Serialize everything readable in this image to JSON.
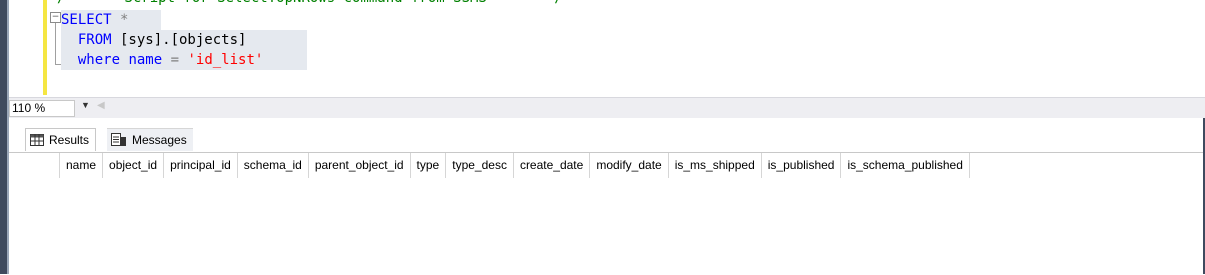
{
  "editor": {
    "comment_line": "/****** Script for SelectTopNRows command from SSMS  ******/",
    "line1_keyword": "SELECT",
    "line1_rest": " *",
    "line2_keyword": "FROM",
    "line2_rest": " [sys].[objects]",
    "line3_keyword": "where",
    "line3_ident": " name ",
    "line3_op": "=",
    "line3_string": " 'id_list'"
  },
  "zoom": {
    "value": "110 %"
  },
  "tabs": {
    "results": "Results",
    "messages": "Messages"
  },
  "grid": {
    "columns": [
      "name",
      "object_id",
      "principal_id",
      "schema_id",
      "parent_object_id",
      "type",
      "type_desc",
      "create_date",
      "modify_date",
      "is_ms_shipped",
      "is_published",
      "is_schema_published"
    ]
  },
  "icons": {
    "results_tab_icon": "grid-icon",
    "messages_tab_icon": "messages-icon",
    "zoom_dropdown": "chevron-down-icon"
  }
}
